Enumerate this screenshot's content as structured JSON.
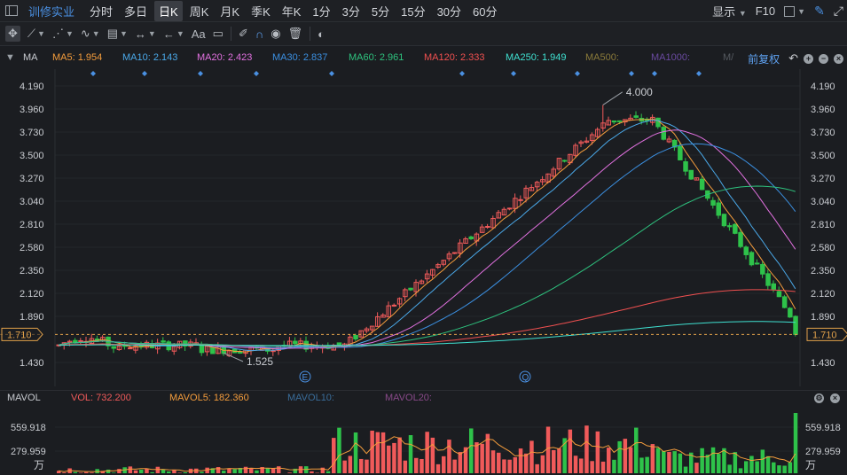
{
  "toolbar": {
    "stock_name": "训修实业",
    "periods": [
      "分时",
      "多日",
      "日K",
      "周K",
      "月K",
      "季K",
      "年K",
      "1分",
      "3分",
      "5分",
      "15分",
      "30分",
      "60分"
    ],
    "active_period": "日K",
    "display_label": "显示",
    "f10_label": "F10"
  },
  "drawing_tools": [
    "crosshair-icon",
    "line-tool-icon",
    "trend-tool-icon",
    "wave-tool-icon",
    "channel-tool-icon",
    "range-tool-icon",
    "arrow-tool-icon",
    "text-tool-icon",
    "comment-tool-icon",
    "eraser-icon",
    "magnet-icon",
    "eye-icon",
    "trash-icon",
    "toggle-icon"
  ],
  "text_tool_label": "Aa",
  "ma_legend": {
    "title": "MA",
    "items": [
      {
        "label": "MA5: 1.954",
        "color": "#f39c3c"
      },
      {
        "label": "MA10: 2.143",
        "color": "#4aa8e8"
      },
      {
        "label": "MA20: 2.423",
        "color": "#e271e0"
      },
      {
        "label": "MA30: 2.837",
        "color": "#3b8fe0"
      },
      {
        "label": "MA60: 2.961",
        "color": "#2ec27e"
      },
      {
        "label": "MA120: 2.333",
        "color": "#f05050"
      },
      {
        "label": "MA250: 1.949",
        "color": "#3fe0d0"
      },
      {
        "label": "MA500:",
        "color": "#8a7a3a"
      },
      {
        "label": "MA1000:",
        "color": "#6a4aa0"
      },
      {
        "label": "M/",
        "color": "#555a60"
      }
    ],
    "adjust_label": "前复权"
  },
  "price_axis": {
    "ticks": [
      "4.190",
      "3.960",
      "3.730",
      "3.500",
      "3.270",
      "3.040",
      "2.810",
      "2.580",
      "2.350",
      "2.120",
      "1.890",
      "1.710",
      "1.430"
    ],
    "current_price": "1.710",
    "high_label": "4.000",
    "low_label": "1.525"
  },
  "event_markers": [
    "E",
    "Q"
  ],
  "volume": {
    "title": "MAVOL",
    "items": [
      {
        "label": "VOL: 732.200",
        "color": "#f05a5a"
      },
      {
        "label": "MAVOL5: 182.360",
        "color": "#f39c3c"
      },
      {
        "label": "MAVOL10:",
        "color": "#3a6d9a"
      },
      {
        "label": "MAVOL20:",
        "color": "#8a4a8a"
      }
    ],
    "ticks": [
      "559.918",
      "279.959"
    ],
    "unit": "万"
  },
  "colors": {
    "up": "#f05a5a",
    "down": "#2ec24a",
    "accent": "#4a90e2"
  }
}
